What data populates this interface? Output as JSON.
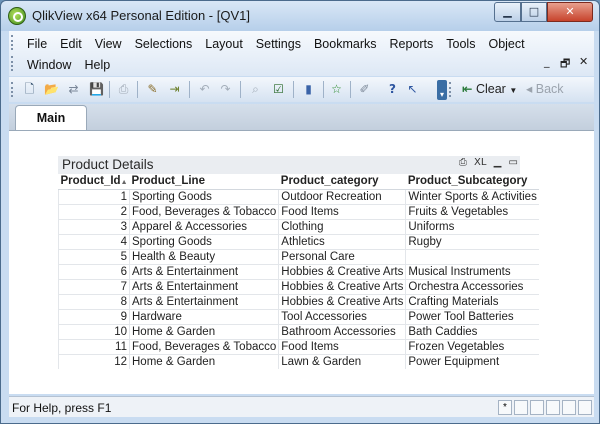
{
  "window": {
    "title": "QlikView x64 Personal Edition - [QV1]",
    "min_glyph": "▁",
    "max_glyph": "□",
    "close_glyph": "✕"
  },
  "menu": {
    "items_row1": [
      "File",
      "Edit",
      "View",
      "Selections",
      "Layout",
      "Settings",
      "Bookmarks",
      "Reports",
      "Tools",
      "Object"
    ],
    "items_row2": [
      "Window",
      "Help"
    ],
    "doc_min_glyph": "_",
    "doc_restore_glyph": "🗗",
    "doc_close_glyph": "✕"
  },
  "toolbar": {
    "clear_label": "Clear",
    "back_label": "Back",
    "icons": [
      "new-file-icon",
      "open-folder-icon",
      "reload-icon",
      "save-icon",
      "print-icon",
      "edit-script-icon",
      "reload-data-icon",
      "undo-icon",
      "redo-icon",
      "search-icon",
      "select-fields-icon",
      "chart-icon",
      "bookmark-star-icon",
      "edit-icon",
      "help-icon",
      "context-help-icon"
    ]
  },
  "tabs": [
    {
      "label": "Main"
    }
  ],
  "table_box": {
    "title": "Product Details",
    "caption_icons": {
      "print": "⎙",
      "xl": "XL",
      "minimize": "▁",
      "maximize": "▭"
    },
    "columns": [
      "Product_Id",
      "Product_Line",
      "Product_category",
      "Product_Subcategory"
    ],
    "sort_indicator": "▲",
    "rows": [
      [
        "1",
        "Sporting Goods",
        "Outdoor Recreation",
        "Winter Sports & Activities"
      ],
      [
        "2",
        "Food, Beverages & Tobacco",
        "Food Items",
        "Fruits & Vegetables"
      ],
      [
        "3",
        "Apparel & Accessories",
        "Clothing",
        "Uniforms"
      ],
      [
        "4",
        "Sporting Goods",
        "Athletics",
        "Rugby"
      ],
      [
        "5",
        "Health & Beauty",
        "Personal Care",
        ""
      ],
      [
        "6",
        "Arts & Entertainment",
        "Hobbies & Creative Arts",
        "Musical Instruments"
      ],
      [
        "7",
        "Arts & Entertainment",
        "Hobbies & Creative Arts",
        "Orchestra Accessories"
      ],
      [
        "8",
        "Arts & Entertainment",
        "Hobbies & Creative Arts",
        "Crafting Materials"
      ],
      [
        "9",
        "Hardware",
        "Tool Accessories",
        "Power Tool Batteries"
      ],
      [
        "10",
        "Home & Garden",
        "Bathroom Accessories",
        "Bath Caddies"
      ],
      [
        "11",
        "Food, Beverages & Tobacco",
        "Food Items",
        "Frozen Vegetables"
      ],
      [
        "12",
        "Home & Garden",
        "Lawn & Garden",
        "Power Equipment"
      ]
    ]
  },
  "status": {
    "help_text": "For Help, press F1",
    "indicator": "*"
  }
}
